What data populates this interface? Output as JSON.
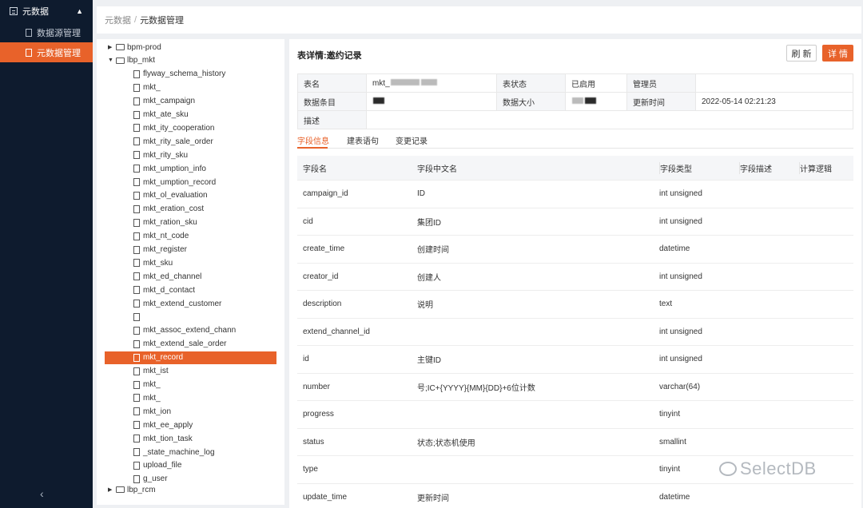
{
  "sidebar": {
    "group_label": "元数据",
    "items": [
      {
        "label": "数据源管理",
        "active": false
      },
      {
        "label": "元数据管理",
        "active": true
      }
    ]
  },
  "breadcrumb": {
    "parent": "元数据",
    "separator": "/",
    "current": "元数据管理"
  },
  "tree": {
    "nodes": [
      {
        "label": "bpm-prod",
        "type": "db",
        "expanded": false
      },
      {
        "label": "lbp_mkt",
        "type": "db",
        "expanded": true
      },
      {
        "label": "flyway_schema_history",
        "type": "table"
      },
      {
        "label": "mkt_",
        "type": "table"
      },
      {
        "label": "mkt_campaign",
        "type": "table"
      },
      {
        "label": "mkt_ate_sku",
        "type": "table"
      },
      {
        "label": "mkt_ity_cooperation",
        "type": "table"
      },
      {
        "label": "mkt_rity_sale_order",
        "type": "table"
      },
      {
        "label": "mkt_rity_sku",
        "type": "table"
      },
      {
        "label": "mkt_umption_info",
        "type": "table"
      },
      {
        "label": "mkt_umption_record",
        "type": "table"
      },
      {
        "label": "mkt_ol_evaluation",
        "type": "table"
      },
      {
        "label": "mkt_eration_cost",
        "type": "table"
      },
      {
        "label": "mkt_ration_sku",
        "type": "table"
      },
      {
        "label": "mkt_nt_code",
        "type": "table"
      },
      {
        "label": "mkt_register",
        "type": "table"
      },
      {
        "label": "mkt_sku",
        "type": "table"
      },
      {
        "label": "mkt_ed_channel",
        "type": "table"
      },
      {
        "label": "mkt_d_contact",
        "type": "table"
      },
      {
        "label": "mkt_extend_customer",
        "type": "table"
      },
      {
        "label": "",
        "type": "table"
      },
      {
        "label": "mkt_assoc_extend_chann",
        "type": "table"
      },
      {
        "label": "mkt_extend_sale_order",
        "type": "table"
      },
      {
        "label": "mkt_record",
        "type": "table",
        "selected": true
      },
      {
        "label": "mkt_ist",
        "type": "table"
      },
      {
        "label": "mkt_",
        "type": "table"
      },
      {
        "label": "mkt_",
        "type": "table"
      },
      {
        "label": "mkt_ion",
        "type": "table"
      },
      {
        "label": "mkt_ee_apply",
        "type": "table"
      },
      {
        "label": "mkt_tion_task",
        "type": "table"
      },
      {
        "label": "_state_machine_log",
        "type": "table"
      },
      {
        "label": "upload_file",
        "type": "table"
      },
      {
        "label": "g_user",
        "type": "table"
      },
      {
        "label": "lbp_rcm",
        "type": "db",
        "expanded": false
      }
    ]
  },
  "detail": {
    "title": "表详情:邀约记录",
    "refresh_label": "刷 新",
    "detail_label": "详 情",
    "info": {
      "name_key": "表名",
      "name_val": "mkt_",
      "status_key": "表状态",
      "status_val": "已启用",
      "admin_key": "管理员",
      "admin_val": "",
      "rows_key": "数据条目",
      "rows_val": "",
      "size_key": "数据大小",
      "size_val": "",
      "updated_key": "更新时间",
      "updated_val": "2022-05-14 02:21:23",
      "desc_key": "描述",
      "desc_val": ""
    },
    "tabs": [
      "字段信息",
      "建表语句",
      "变更记录"
    ],
    "active_tab": 0,
    "columns": [
      "字段名",
      "字段中文名",
      "字段类型",
      "字段描述",
      "计算逻辑"
    ],
    "fields": [
      {
        "name": "campaign_id",
        "cn": "ID",
        "type": "int unsigned",
        "desc": "",
        "logic": ""
      },
      {
        "name": "cid",
        "cn": "集团ID",
        "type": "int unsigned",
        "desc": "",
        "logic": ""
      },
      {
        "name": "create_time",
        "cn": "创建时间",
        "type": "datetime",
        "desc": "",
        "logic": ""
      },
      {
        "name": "creator_id",
        "cn": "创建人",
        "type": "int unsigned",
        "desc": "",
        "logic": ""
      },
      {
        "name": "description",
        "cn": "说明",
        "type": "text",
        "desc": "",
        "logic": ""
      },
      {
        "name": "extend_channel_id",
        "cn": "",
        "type": "int unsigned",
        "desc": "",
        "logic": ""
      },
      {
        "name": "id",
        "cn": "主键ID",
        "type": "int unsigned",
        "desc": "",
        "logic": ""
      },
      {
        "name": "number",
        "cn": "号;IC+{YYYY}{MM}{DD}+6位计数",
        "type": "varchar(64)",
        "desc": "",
        "logic": ""
      },
      {
        "name": "progress",
        "cn": "",
        "type": "tinyint",
        "desc": "",
        "logic": ""
      },
      {
        "name": "status",
        "cn": "状态;状态机使用",
        "type": "smallint",
        "desc": "",
        "logic": ""
      },
      {
        "name": "type",
        "cn": "",
        "type": "tinyint",
        "desc": "",
        "logic": ""
      },
      {
        "name": "update_time",
        "cn": "更新时间",
        "type": "datetime",
        "desc": "",
        "logic": ""
      }
    ]
  },
  "watermark": "SelectDB"
}
